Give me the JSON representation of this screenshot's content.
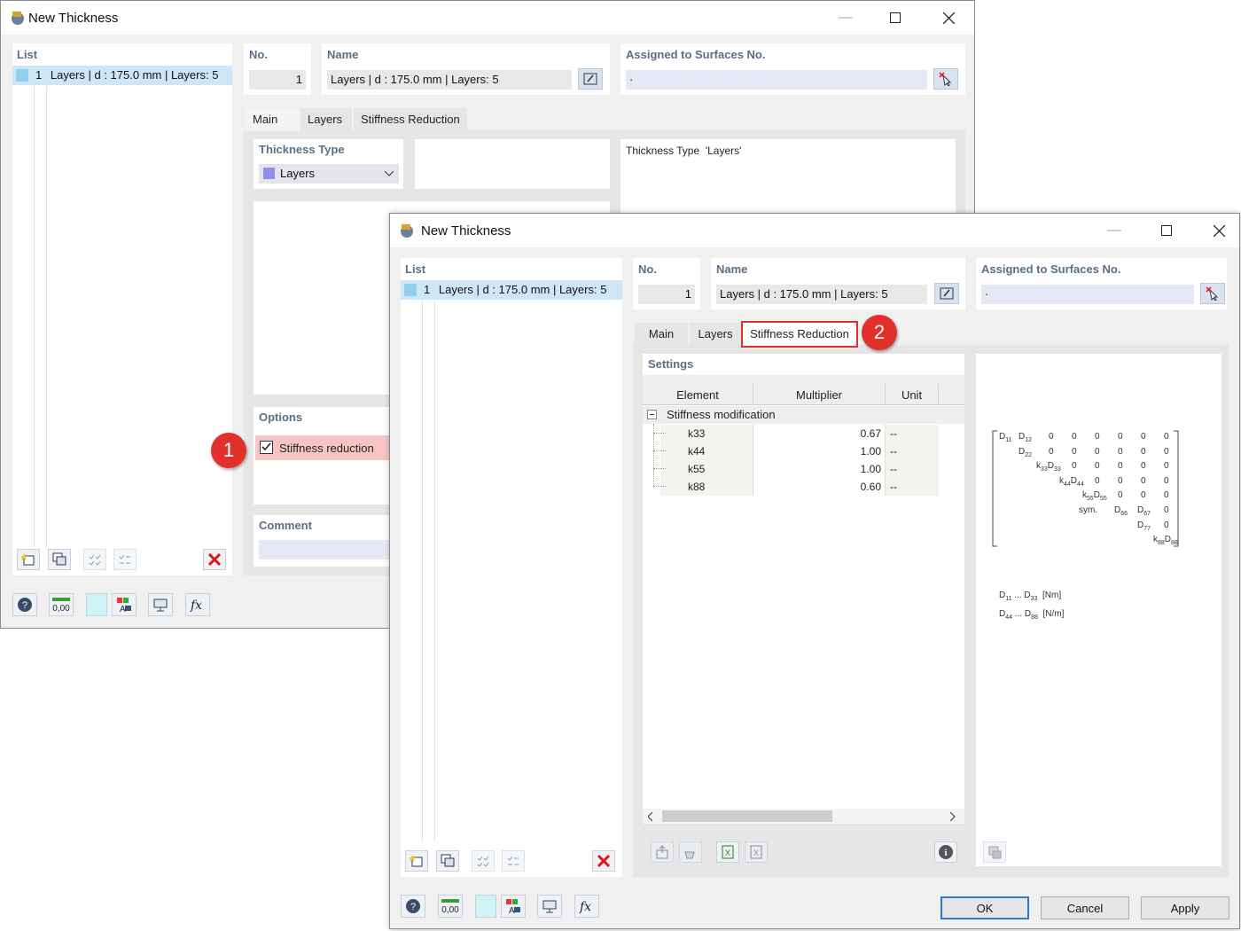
{
  "back_window": {
    "title": "New Thickness",
    "list_label": "List",
    "list_item_no": "1",
    "list_item_text": "Layers | d : 175.0 mm | Layers: 5",
    "no_label": "No.",
    "no_value": "1",
    "name_label": "Name",
    "name_value": "Layers | d : 175.0 mm | Layers: 5",
    "assigned_label": "Assigned to Surfaces No.",
    "assigned_value": "·",
    "tabs": [
      "Main",
      "Layers",
      "Stiffness Reduction"
    ],
    "thickness_type_label": "Thickness Type",
    "thickness_type_value": "Layers",
    "info_text": "Thickness Type  'Layers'",
    "options_label": "Options",
    "stiffness_reduction_label": "Stiffness reduction",
    "comment_label": "Comment",
    "badge": "1"
  },
  "front_window": {
    "title": "New Thickness",
    "list_label": "List",
    "list_item_no": "1",
    "list_item_text": "Layers | d : 175.0 mm | Layers: 5",
    "no_label": "No.",
    "no_value": "1",
    "name_label": "Name",
    "name_value": "Layers | d : 175.0 mm | Layers: 5",
    "assigned_label": "Assigned to Surfaces No.",
    "assigned_value": "·",
    "tabs": [
      "Main",
      "Layers",
      "Stiffness Reduction"
    ],
    "badge": "2",
    "settings_label": "Settings",
    "table": {
      "headers": [
        "Element",
        "Multiplier",
        "Unit"
      ],
      "group": "Stiffness modification",
      "rows": [
        {
          "element": "k33",
          "multiplier": "0.67",
          "unit": "--"
        },
        {
          "element": "k44",
          "multiplier": "1.00",
          "unit": "--"
        },
        {
          "element": "k55",
          "multiplier": "1.00",
          "unit": "--"
        },
        {
          "element": "k88",
          "multiplier": "0.60",
          "unit": "--"
        }
      ]
    },
    "matrix": {
      "sym_label": "sym.",
      "legend_1": "[Nm]",
      "legend_2": "[N/m]"
    },
    "buttons": {
      "ok": "OK",
      "cancel": "Cancel",
      "apply": "Apply"
    }
  }
}
